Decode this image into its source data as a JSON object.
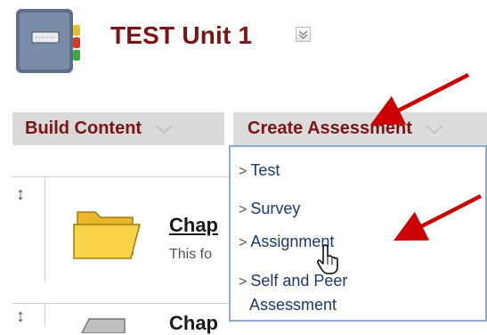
{
  "header": {
    "title": "TEST Unit 1"
  },
  "action_bar": {
    "build_content_label": "Build Content",
    "create_assessment_label": "Create Assessment"
  },
  "content": {
    "row1": {
      "title": "Chap",
      "description": "This fo"
    },
    "row2": {
      "title": "Chap"
    }
  },
  "dropdown": {
    "items": [
      {
        "label": "Test"
      },
      {
        "label": "Survey"
      },
      {
        "label": "Assignment"
      },
      {
        "label": "Self and Peer"
      }
    ],
    "self_peer_line2": "Assessment"
  },
  "colors": {
    "accent": "#7a1515",
    "annotation_arrow": "#cc0000",
    "menu_border": "#8faad0",
    "menu_text": "#1a3a70"
  },
  "icons": [
    "unit-notebook-icon",
    "chevron-down-icon",
    "folder-icon",
    "hand-pointer-icon",
    "move-handle-icon"
  ]
}
